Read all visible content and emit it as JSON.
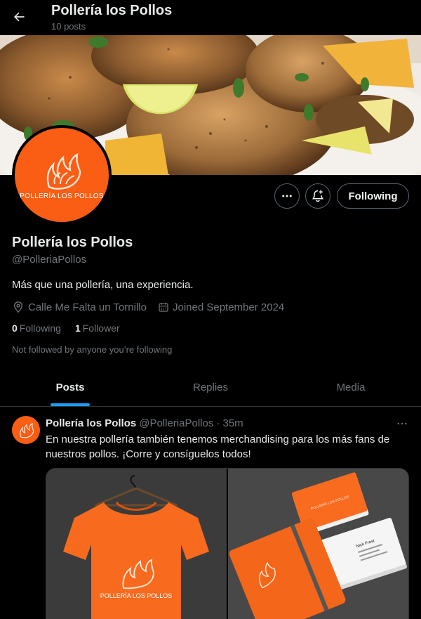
{
  "header": {
    "title": "Pollería los Pollos",
    "post_count": "10 posts"
  },
  "profile": {
    "avatar_text": "POLLERÍA LOS POLLOS",
    "display_name": "Pollería los Pollos",
    "handle": "@PolleriaPollos",
    "bio": "Más que una pollería, una experiencia.",
    "location": "Calle Me Falta un Tornillo",
    "joined": "Joined September 2024",
    "following_count": "0",
    "following_label": "Following",
    "followers_count": "1",
    "followers_label": "Follower",
    "not_followed_text": "Not followed by anyone you’re following",
    "follow_button_label": "Following"
  },
  "tabs": [
    {
      "label": "Posts",
      "active": true
    },
    {
      "label": "Replies",
      "active": false
    },
    {
      "label": "Media",
      "active": false
    }
  ],
  "post": {
    "author_name": "Pollería los Pollos",
    "author_handle": "@PolleriaPollos",
    "time": "· 35m",
    "text": "En nuestra pollería también tenemos merchandising para los más fans de nuestros pollos. ¡Corre y consíguelos todos!",
    "tshirt_text": "POLLERÍA LOS POLLOS",
    "card_name": "Nick Frost"
  },
  "colors": {
    "brand_orange": "#fa5d14",
    "accent_blue": "#1d9bf0",
    "muted": "#71767b"
  },
  "icons": [
    "back-arrow-icon",
    "more-icon",
    "notification-add-icon",
    "location-icon",
    "calendar-icon",
    "phoenix-logo-icon"
  ]
}
